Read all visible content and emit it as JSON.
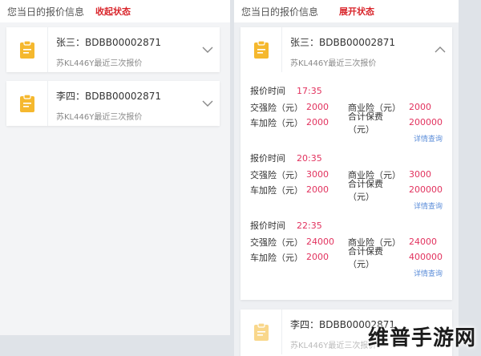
{
  "left": {
    "header_title": "您当日的报价信息",
    "state_label": "收起状态",
    "cards": [
      {
        "name": "张三：BDBB00002871",
        "plate": "苏KL446Y最近三次报价",
        "icon": "clipboard-icon",
        "chevron": "chevron-down-icon"
      },
      {
        "name": "李四：BDBB00002871",
        "plate": "苏KL446Y最近三次报价",
        "icon": "clipboard-icon",
        "chevron": "chevron-down-icon"
      }
    ]
  },
  "right": {
    "header_title": "您当日的报价信息",
    "state_label": "展开状态",
    "expanded_card": {
      "name": "张三：BDBB00002871",
      "plate": "苏KL446Y最近三次报价",
      "icon": "clipboard-icon",
      "chevron": "chevron-up-icon",
      "quotes": [
        {
          "time_label": "报价时间",
          "time": "17:35",
          "jqx_label": "交强险（元）",
          "jqx": "2000",
          "syx_label": "商业险（元）",
          "syx": "2000",
          "cjx_label": "车加险（元）",
          "cjx": "2000",
          "total_label": "合计保费（元）",
          "total": "200000",
          "detail": "详情查询"
        },
        {
          "time_label": "报价时间",
          "time": "20:35",
          "jqx_label": "交强险（元）",
          "jqx": "3000",
          "syx_label": "商业险（元）",
          "syx": "3000",
          "cjx_label": "车加险（元）",
          "cjx": "2000",
          "total_label": "合计保费（元）",
          "total": "200000",
          "detail": "详情查询"
        },
        {
          "time_label": "报价时间",
          "time": "22:35",
          "jqx_label": "交强险（元）",
          "jqx": "24000",
          "syx_label": "商业险（元）",
          "syx": "24000",
          "cjx_label": "车加险（元）",
          "cjx": "2000",
          "total_label": "合计保费（元）",
          "total": "400000",
          "detail": "详情查询"
        }
      ]
    },
    "second_card": {
      "name": "李四：BDBB00002871",
      "plate": "苏KL446Y最近三次报价",
      "icon": "clipboard-icon"
    }
  },
  "watermark": "维普手游网",
  "colors": {
    "accent_red": "#d9262c",
    "value_pink": "#e2325e",
    "icon_yellow": "#f5b82e",
    "link_blue": "#5b8dd9"
  }
}
